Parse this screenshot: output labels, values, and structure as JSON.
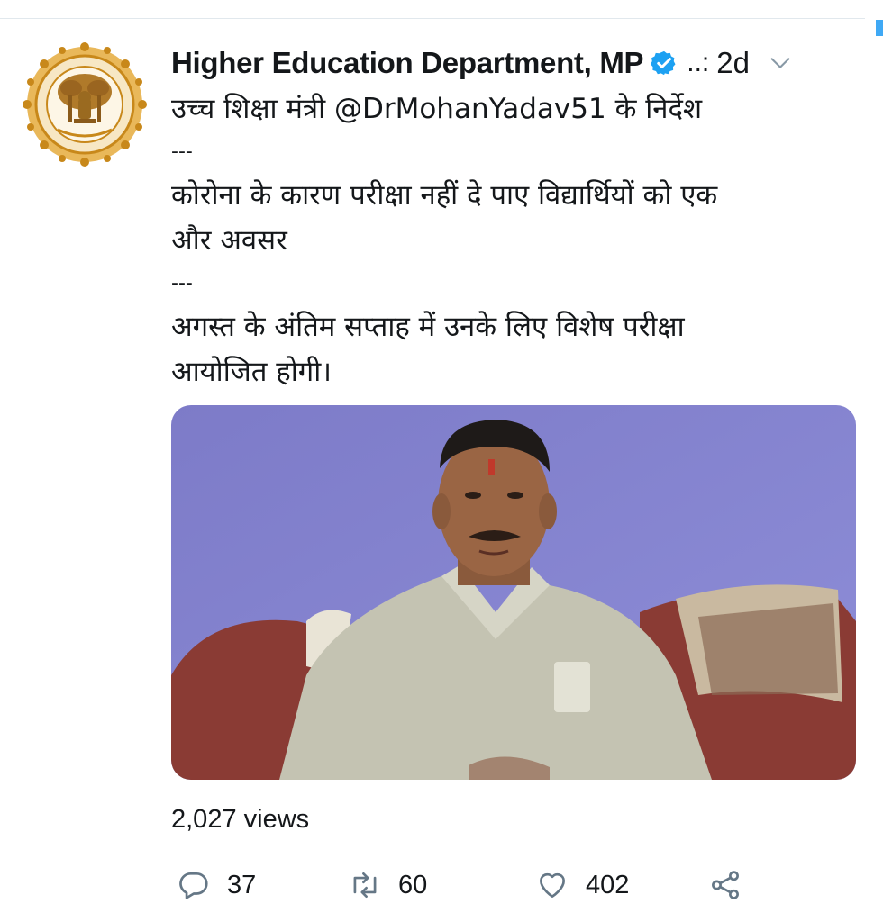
{
  "tweet": {
    "display_name": "Higher Education Department, MP",
    "handle": "..:",
    "time": "2d",
    "text": {
      "line1_prefix": "उच्च शिक्षा मंत्री ",
      "mention": "@DrMohanYadav51",
      "line1_suffix": "  के निर्देश",
      "separator": "---",
      "line2": "कोरोना के कारण परीक्षा नहीं दे पाए विद्यार्थियों को एक",
      "line3": "और अवसर",
      "line4": "अगस्त के अंतिम सप्ताह में उनके लिए विशेष परीक्षा",
      "line5": "आयोजित होगी।"
    },
    "views": "2,027 views",
    "reply_count": "37",
    "retweet_count": "60",
    "like_count": "402"
  },
  "icons": {
    "verified": "verified-badge-icon",
    "caret": "chevron-down-icon",
    "reply": "reply-icon",
    "retweet": "retweet-icon",
    "like": "heart-icon",
    "share": "share-icon"
  },
  "colors": {
    "verified_blue": "#1da1f2",
    "icon_gray": "#657786",
    "emblem_gold": "#c8881a"
  }
}
